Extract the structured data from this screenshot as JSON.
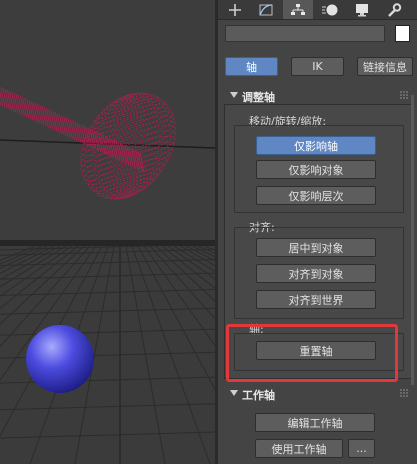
{
  "colors": {
    "spline_color": "#b01e4f",
    "sphere_color": "#3e3ed0",
    "active_button": "#5f87c4",
    "highlight_border": "#e0393b",
    "swatch": "#ffffff"
  },
  "command_panel": {
    "tabs": [
      {
        "icon": "plus-icon"
      },
      {
        "icon": "modify-curve-icon"
      },
      {
        "icon": "hierarchy-icon"
      },
      {
        "icon": "motion-icon"
      },
      {
        "icon": "display-icon"
      },
      {
        "icon": "utilities-wrench-icon"
      }
    ],
    "name_value": "",
    "subtabs": {
      "pivot": "轴",
      "ik": "IK",
      "link_info": "链接信息"
    },
    "adjust_pivot": {
      "title": "调整轴",
      "move_rotate_scale_label": "移动/旋转/缩放:",
      "affect_pivot_only": "仅影响轴",
      "affect_object_only": "仅影响对象",
      "affect_hierarchy_only": "仅影响层次",
      "align_label": "对齐:",
      "center_to_object": "居中到对象",
      "align_to_object": "对齐到对象",
      "align_to_world": "对齐到世界",
      "pivot_label": "轴:",
      "reset_pivot": "重置轴"
    },
    "working_pivot": {
      "title": "工作轴",
      "edit_working_pivot": "编辑工作轴",
      "use_working_pivot": "使用工作轴",
      "more": "..."
    }
  }
}
